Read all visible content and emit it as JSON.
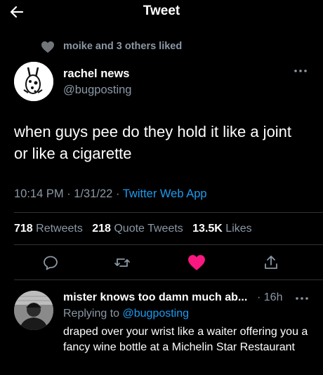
{
  "header": {
    "title": "Tweet"
  },
  "social_context": {
    "text": "moike and 3 others liked"
  },
  "tweet": {
    "author_name": "rachel news",
    "author_handle": "@bugposting",
    "text": "when guys pee do they hold it like a joint or like a cigarette",
    "time": "10:14 PM",
    "date": "1/31/22",
    "sep1": " · ",
    "sep2": " · ",
    "app": "Twitter Web App"
  },
  "stats": {
    "retweets_count": "718",
    "retweets_label": "Retweets",
    "quotes_count": "218",
    "quotes_label": "Quote Tweets",
    "likes_count": "13.5K",
    "likes_label": "Likes"
  },
  "reply": {
    "author_name": "mister knows too damn much ab...",
    "time": "· 16h",
    "replying_to_label": "Replying to",
    "replying_to_handle": "@bugposting",
    "text": "draped over your wrist like a waiter offering you a fancy wine bottle at a Michelin Star Restaurant"
  },
  "icons": {
    "back": "arrow-left-icon",
    "heart_small": "heart-icon",
    "more": "more-dots-icon",
    "reply": "comment-icon",
    "retweet": "retweet-icon",
    "like": "heart-filled-icon",
    "share": "share-icon"
  },
  "colors": {
    "background": "#000000",
    "accent": "#1d9bf0",
    "like": "#f91880",
    "muted": "#8b98a5"
  }
}
